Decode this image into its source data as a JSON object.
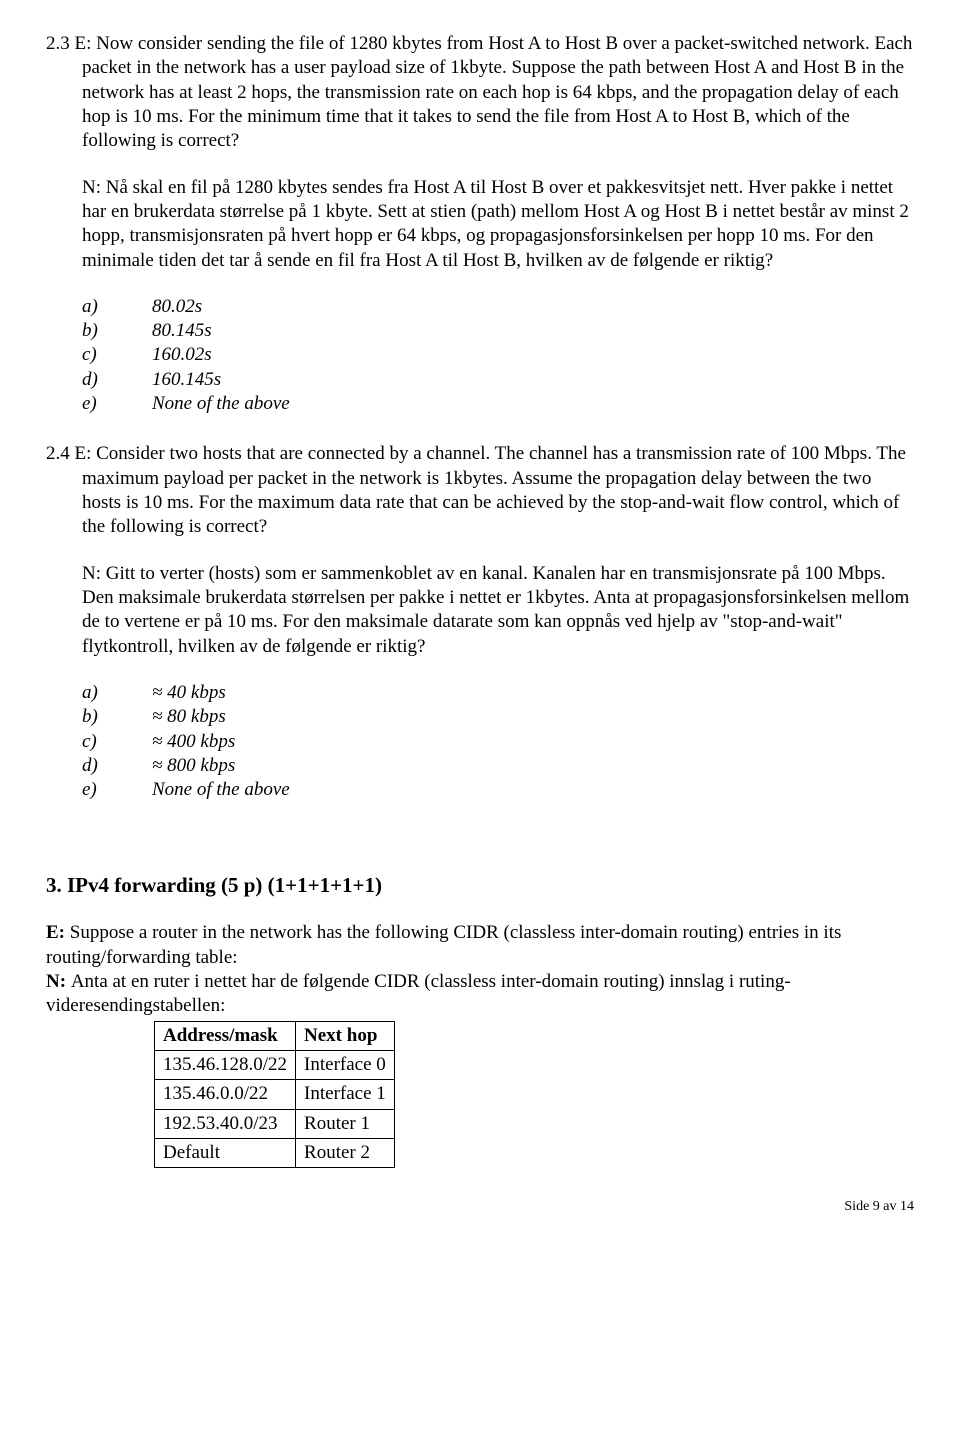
{
  "q23": {
    "num": "2.3",
    "en": "E: Now consider sending the file of 1280 kbytes from Host A to Host B over a packet-switched network. Each packet in the network has a user payload size of 1kbyte. Suppose the path between Host A and Host B in the network has at least 2 hops, the transmission rate on each hop is 64 kbps, and the propagation delay of each hop is 10 ms. For the minimum time that it takes to send the file from Host A to Host B, which of the following is correct?",
    "no": "N: Nå skal en fil på 1280 kbytes sendes fra Host A til Host B over et pakkesvitsjet nett. Hver pakke i nettet har en brukerdata størrelse på 1 kbyte. Sett at stien (path) mellom Host A og Host B i nettet består av minst 2 hopp, transmisjonsraten på hvert hopp er 64 kbps, og propagasjonsforsinkelsen per hopp 10 ms. For den minimale tiden det tar å sende en fil fra Host A til Host B, hvilken av de følgende er riktig?",
    "opts": {
      "a": "80.02s",
      "b": "80.145s",
      "c": "160.02s",
      "d": "160.145s",
      "e": "None of the above"
    }
  },
  "q24": {
    "num": "2.4",
    "en": "E: Consider two hosts that are connected by a channel. The channel has a transmission rate of 100 Mbps. The maximum payload per packet in the network is 1kbytes. Assume the propagation delay between the two hosts is 10 ms. For the maximum data rate that can be achieved by the stop-and-wait flow control, which of the following is correct?",
    "no": "N: Gitt to verter (hosts) som er sammenkoblet av en kanal. Kanalen har en transmisjonsrate på 100 Mbps. Den maksimale brukerdata størrelsen per pakke i nettet er 1kbytes. Anta at propagasjonsforsinkelsen mellom de to vertene er på 10 ms.  For den maksimale datarate som kan oppnås ved hjelp av \"stop-and-wait\" flytkontroll, hvilken av de følgende er riktig?",
    "opts": {
      "a": "≈ 40 kbps",
      "b": "≈ 80 kbps",
      "c": "≈ 400 kbps",
      "d": "≈ 800 kbps",
      "e": "None of the above"
    }
  },
  "sec3": {
    "title": "3. IPv4 forwarding (5 p) (1+1+1+1+1)",
    "en_lead": "E: ",
    "en": "Suppose a router in the network has the following CIDR (classless inter-domain routing) entries in its routing/forwarding table:",
    "no_lead": "N: ",
    "no": "Anta at en ruter i nettet har de følgende CIDR (classless inter-domain routing) innslag i ruting-videresendingstabellen:",
    "table": {
      "headers": {
        "c1": "Address/mask",
        "c2": "Next hop"
      },
      "rows": [
        {
          "c1": "135.46.128.0/22",
          "c2": "Interface 0"
        },
        {
          "c1": "135.46.0.0/22",
          "c2": "Interface 1"
        },
        {
          "c1": "192.53.40.0/23",
          "c2": "Router 1"
        },
        {
          "c1": "Default",
          "c2": "Router 2"
        }
      ]
    }
  },
  "labels": {
    "a": "a)",
    "b": "b)",
    "c": "c)",
    "d": "d)",
    "e": "e)"
  },
  "footer": "Side 9 av 14"
}
